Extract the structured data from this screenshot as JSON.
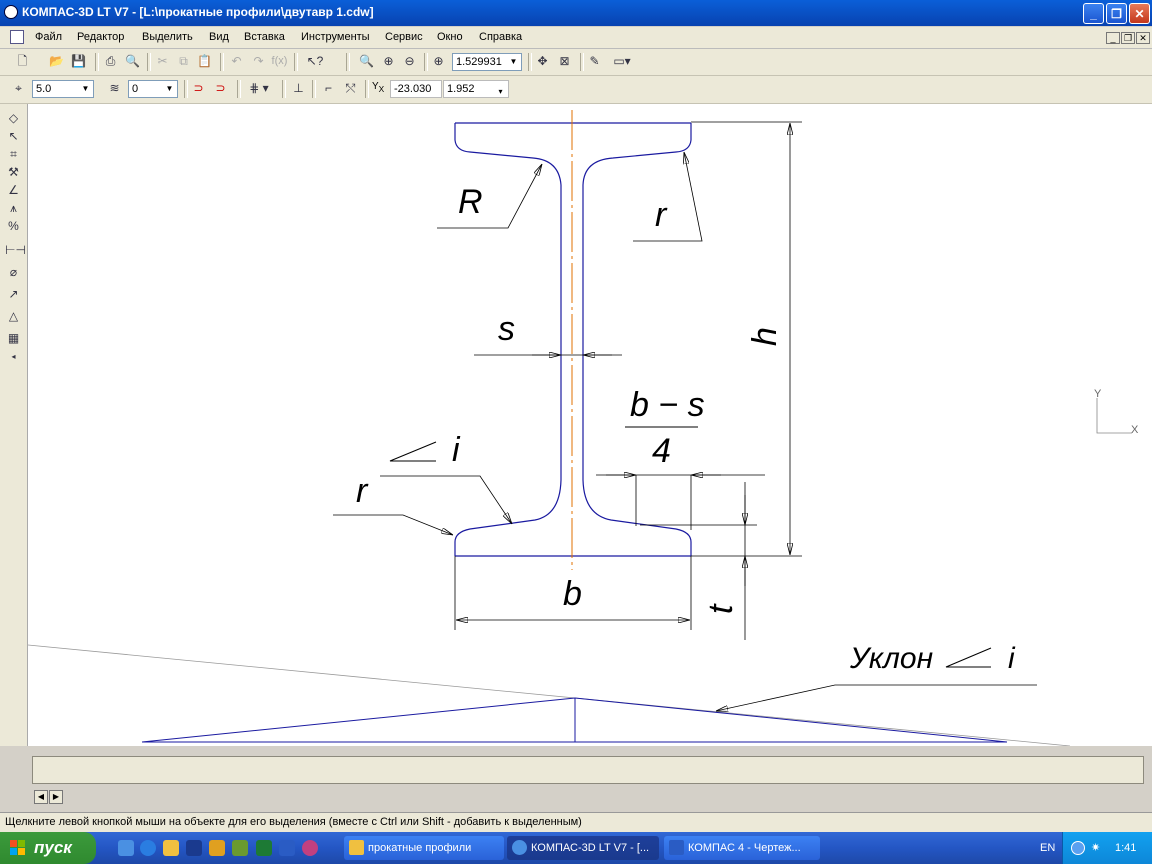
{
  "window": {
    "title": "КОМПАС-3D LT V7 - [L:\\прокатные профили\\двутавр 1.cdw]"
  },
  "menu": {
    "items": [
      "Файл",
      "Редактор",
      "Выделить",
      "Вид",
      "Вставка",
      "Инструменты",
      "Сервис",
      "Окно",
      "Справка"
    ]
  },
  "toolbar1": {
    "zoom_value": "1.529931"
  },
  "toolbar2": {
    "step_value": "5.0",
    "layer_value": "0",
    "coord_x": "-23.030",
    "coord_y": "1.952",
    "coord_label": "Y",
    "coord_sub": "X"
  },
  "drawing": {
    "labels": {
      "R": "R",
      "r_top": "r",
      "s": "s",
      "h": "h",
      "b_minus_s": "b − s",
      "four": "4",
      "slope_i": "i",
      "r_bottom": "r",
      "b": "b",
      "t": "t",
      "slope_label": "Уклон",
      "slope_label_i": "i"
    },
    "axis": {
      "y": "Y",
      "x": "X"
    },
    "colors": {
      "outline": "#1a1aa0",
      "centerline": "#e07000",
      "dim": "#000000"
    }
  },
  "status": {
    "hint": "Щелкните левой кнопкой мыши на объекте для его выделения (вместе с Ctrl или Shift - добавить к выделенным)"
  },
  "taskbar": {
    "start_label": "пуск",
    "tasks": [
      {
        "label": "прокатные профили",
        "icon": "folder-icon"
      },
      {
        "label": "КОМПАС-3D LT V7 - [...",
        "icon": "kompas-icon"
      },
      {
        "label": "КОМПАС 4 - Чертеж...",
        "icon": "word-icon"
      }
    ],
    "lang": "EN",
    "clock": "1:41"
  }
}
